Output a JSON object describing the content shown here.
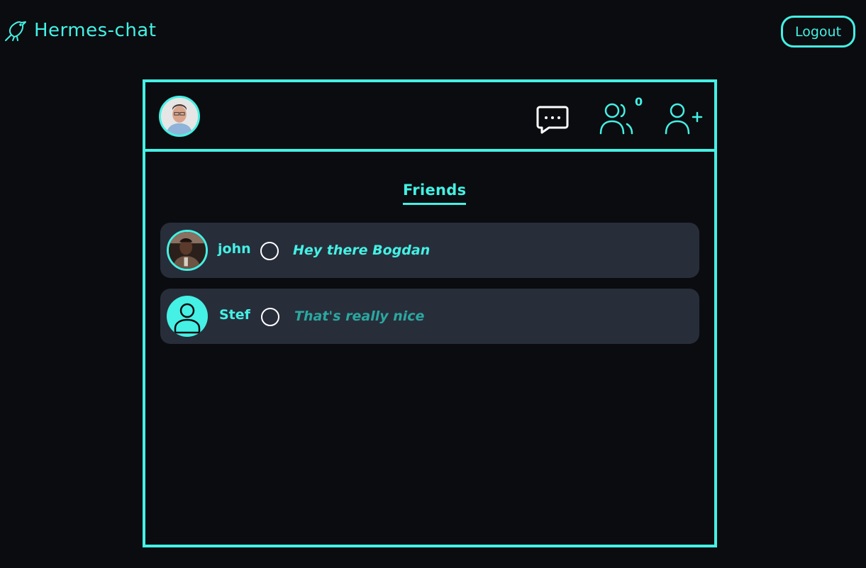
{
  "app": {
    "title": "Hermes-chat",
    "logout_label": "Logout"
  },
  "header": {
    "friend_requests_count": "0"
  },
  "tabs": {
    "friends_label": "Friends"
  },
  "friends": [
    {
      "name": "john",
      "last_message": "Hey there Bogdan",
      "avatar": "photo",
      "message_state": "unread"
    },
    {
      "name": "Stef",
      "last_message": "That's really nice",
      "avatar": "default-user-icon",
      "message_state": "read"
    }
  ],
  "colors": {
    "accent": "#44f1e4",
    "background": "#0a0c10",
    "row_background": "#282d3a",
    "read_message": "#2aa8a0"
  }
}
